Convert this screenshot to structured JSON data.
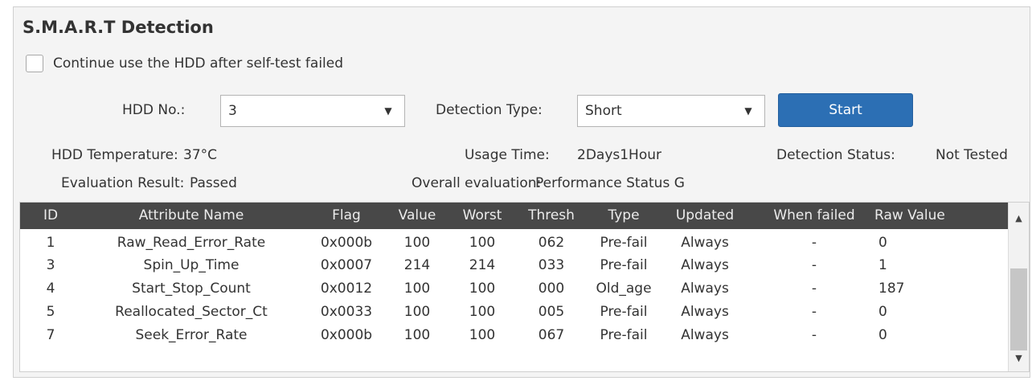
{
  "title": "S.M.A.R.T Detection",
  "continue_checkbox": {
    "label": "Continue use the HDD after self-test failed",
    "checked": false
  },
  "hdd_no": {
    "label": "HDD No.:",
    "value": "3"
  },
  "detection_type": {
    "label": "Detection Type:",
    "value": "Short"
  },
  "start_button": "Start",
  "info": {
    "temperature_label": "HDD Temperature:",
    "temperature_value": "37°C",
    "usage_label": "Usage Time:",
    "usage_value": "2Days1Hour",
    "status_label": "Detection Status:",
    "status_value": "Not Tested",
    "evaluation_label": "Evaluation Result:",
    "evaluation_value": "Passed",
    "overall_label": "Overall evaluation:",
    "overall_value": "Performance Status G"
  },
  "table": {
    "headers": [
      "ID",
      "Attribute Name",
      "Flag",
      "Value",
      "Worst",
      "Thresh",
      "Type",
      "Updated",
      "When failed",
      "Raw Value"
    ],
    "rows": [
      [
        "1",
        "Raw_Read_Error_Rate",
        "0x000b",
        "100",
        "100",
        "062",
        "Pre-fail",
        "Always",
        "-",
        "0"
      ],
      [
        "3",
        "Spin_Up_Time",
        "0x0007",
        "214",
        "214",
        "033",
        "Pre-fail",
        "Always",
        "-",
        "1"
      ],
      [
        "4",
        "Start_Stop_Count",
        "0x0012",
        "100",
        "100",
        "000",
        "Old_age",
        "Always",
        "-",
        "187"
      ],
      [
        "5",
        "Reallocated_Sector_Ct",
        "0x0033",
        "100",
        "100",
        "005",
        "Pre-fail",
        "Always",
        "-",
        "0"
      ],
      [
        "7",
        "Seek_Error_Rate",
        "0x000b",
        "100",
        "100",
        "067",
        "Pre-fail",
        "Always",
        "-",
        "0"
      ]
    ]
  },
  "icons": {
    "dropdown": "chevron-down-icon",
    "scroll_up": "scroll-up-icon",
    "scroll_down": "scroll-down-icon"
  },
  "colors": {
    "accent": "#2c6fb4",
    "header_bg": "#484848"
  }
}
